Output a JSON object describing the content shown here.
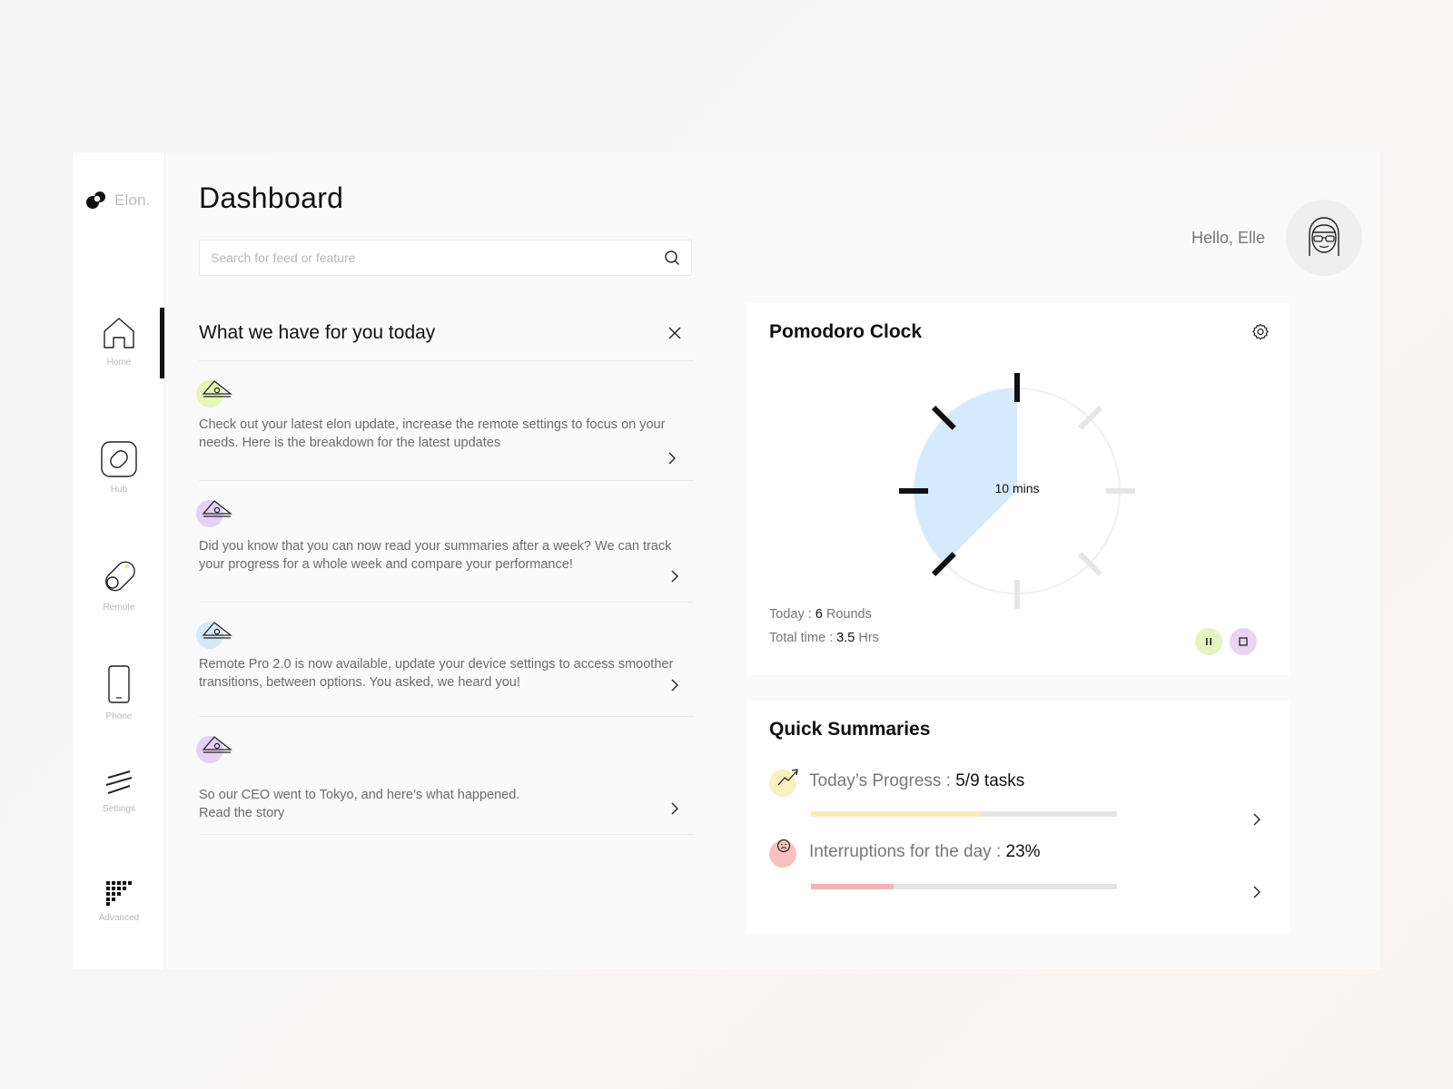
{
  "brand": {
    "name": "Elon."
  },
  "nav": {
    "items": [
      {
        "label": "Home",
        "icon": "home-icon"
      },
      {
        "label": "Hub",
        "icon": "hub-icon"
      },
      {
        "label": "Remote",
        "icon": "remote-icon"
      },
      {
        "label": "Phone",
        "icon": "phone-icon"
      },
      {
        "label": "Settings",
        "icon": "settings-lines-icon"
      },
      {
        "label": "Advanced",
        "icon": "grid-icon"
      }
    ],
    "active": "Home"
  },
  "header": {
    "title": "Dashboard",
    "search_placeholder": "Search for feed or feature",
    "greeting": "Hello, Elle"
  },
  "feed": {
    "title": "What we have for you today",
    "items": [
      {
        "text": "Check out your latest elon update, increase the remote settings to focus on your needs. Here is the breakdown for the latest updates",
        "accent": "#e6f6b8"
      },
      {
        "text": "Did you know that you can now read your summaries after a week? We can track your progress for a whole week and compare your performance!",
        "accent": "#e6d0f4"
      },
      {
        "text": "Remote Pro 2.0 is now available, update your device settings to access smoother transitions, between options. You asked, we heard you!",
        "accent": "#d4e9f8"
      },
      {
        "text": "So our CEO went to Tokyo, and here’s what happened.\nRead the story",
        "accent": "#e6d0f4"
      }
    ]
  },
  "pomodoro": {
    "title": "Pomodoro Clock",
    "clock_label": "10 mins",
    "elapsed_fraction": 0.375,
    "today_label": "Today : ",
    "today_value": "6",
    "today_unit": " Rounds",
    "total_label": "Total time : ",
    "total_value": "3.5",
    "total_unit": " Hrs",
    "pause_color": "#e5f5c2",
    "stop_color": "#e9d4f4"
  },
  "summaries": {
    "title": "Quick Summaries",
    "progress": {
      "label": "Today’s Progress : ",
      "value": "5/9 tasks",
      "fraction": 0.5556,
      "color": "#fbe9b8",
      "icon_bg": "#fcefc0"
    },
    "interruptions": {
      "label": "Interruptions for the day : ",
      "value": "23%",
      "fraction": 0.27,
      "color": "#f5b3b3",
      "icon_bg": "#f8c1c1"
    }
  }
}
